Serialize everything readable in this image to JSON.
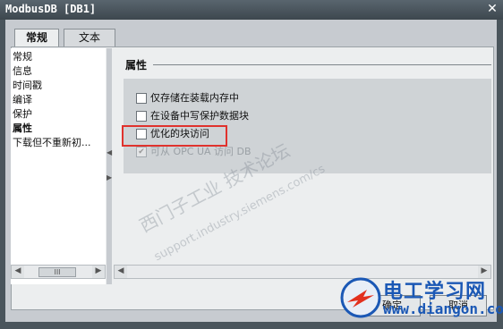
{
  "window": {
    "title": "ModbusDB [DB1]",
    "close_glyph": "✕"
  },
  "tabs": [
    {
      "label": "常规"
    },
    {
      "label": "文本"
    }
  ],
  "nav": {
    "items": [
      {
        "label": "常规"
      },
      {
        "label": "信息"
      },
      {
        "label": "时间戳"
      },
      {
        "label": "编译"
      },
      {
        "label": "保护"
      },
      {
        "label": "属性"
      },
      {
        "label": "下载但不重新初..."
      }
    ],
    "selected_index": 5
  },
  "scroll": {
    "left": "◀",
    "right": "▶",
    "thumb": "III",
    "split_left": "◀",
    "split_right": "▶"
  },
  "section": {
    "title": "属性"
  },
  "options": [
    {
      "label": "仅存储在装载内存中",
      "checked": false,
      "enabled": true
    },
    {
      "label": "在设备中写保护数据块",
      "checked": false,
      "enabled": true
    },
    {
      "label": "优化的块访问",
      "checked": false,
      "enabled": true
    },
    {
      "label": "可从 OPC UA 访问 DB",
      "checked": true,
      "enabled": false,
      "check_glyph": "✔"
    }
  ],
  "footer": {
    "ok_label": "确定",
    "cancel_label": "取消"
  },
  "watermark": {
    "line1": "西门子工业 技术论坛",
    "line2": "support.industry.siemens.com/cs"
  },
  "logo": {
    "name_cn": "电工学习网",
    "url": "www.diangon.com"
  }
}
